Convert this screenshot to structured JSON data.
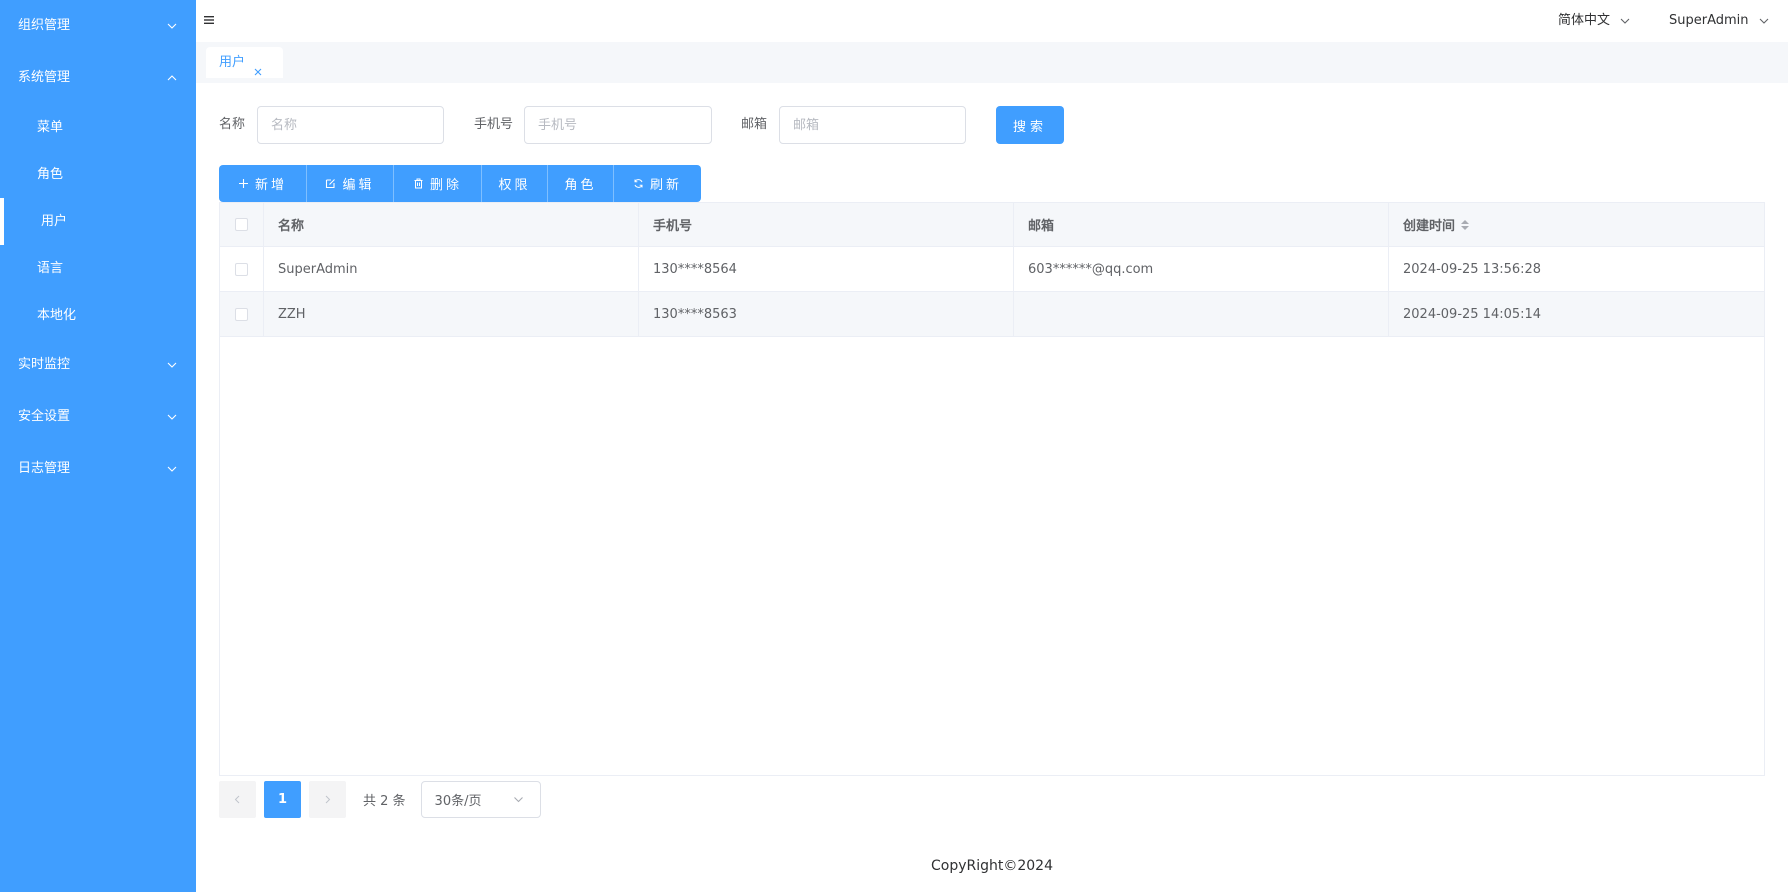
{
  "sidebar": {
    "groups": [
      {
        "label": "组织管理",
        "expanded": false
      },
      {
        "label": "系统管理",
        "expanded": true
      },
      {
        "label": "实时监控",
        "expanded": false
      },
      {
        "label": "安全设置",
        "expanded": false
      },
      {
        "label": "日志管理",
        "expanded": false
      }
    ],
    "sub_items": [
      {
        "label": "菜单"
      },
      {
        "label": "角色"
      },
      {
        "label": "用户",
        "active": true
      },
      {
        "label": "语言"
      },
      {
        "label": "本地化"
      }
    ]
  },
  "header": {
    "menu_toggle_icon": "hamburger-icon",
    "language": "简体中文",
    "user": "SuperAdmin"
  },
  "tabs": [
    {
      "label": "用户",
      "closable": true
    }
  ],
  "search": {
    "name_label": "名称",
    "name_placeholder": "名称",
    "name_value": "",
    "phone_label": "手机号",
    "phone_placeholder": "手机号",
    "phone_value": "",
    "email_label": "邮箱",
    "email_placeholder": "邮箱",
    "email_value": "",
    "button": "搜索"
  },
  "toolbar": {
    "add": "新增",
    "edit": "编辑",
    "delete": "删除",
    "permission": "权限",
    "role": "角色",
    "refresh": "刷新"
  },
  "table": {
    "columns": [
      "名称",
      "手机号",
      "邮箱",
      "创建时间"
    ],
    "rows": [
      {
        "name": "SuperAdmin",
        "phone": "130****8564",
        "email": "603******@qq.com",
        "created": "2024-09-25 13:56:28"
      },
      {
        "name": "ZZH",
        "phone": "130****8563",
        "email": "",
        "created": "2024-09-25 14:05:14"
      }
    ]
  },
  "pagination": {
    "current_page": "1",
    "total": "共 2 条",
    "page_size": "30条/页"
  },
  "footer": "CopyRight©2024",
  "colors": {
    "accent": "#409eff",
    "sidebar_bg": "#409eff",
    "border": "#dcdfe6"
  }
}
